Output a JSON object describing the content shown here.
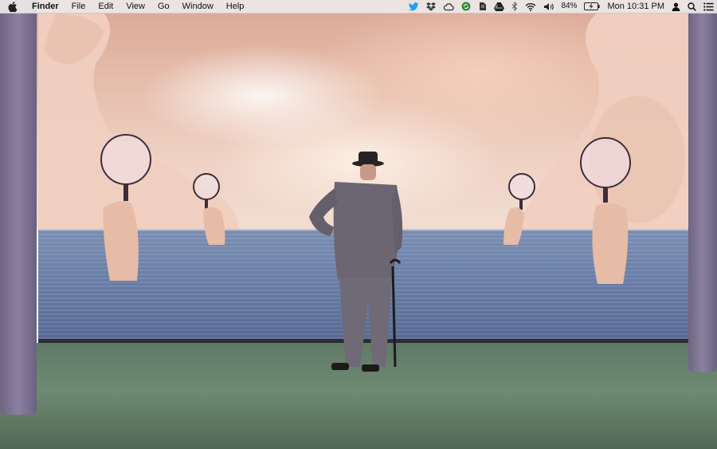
{
  "menubar": {
    "app_name": "Finder",
    "menus": [
      "File",
      "Edit",
      "View",
      "Go",
      "Window",
      "Help"
    ],
    "status_icons": [
      "twitter-bird-icon",
      "dropbox-icon",
      "cloud-app-icon",
      "sync-icon",
      "evernote-icon",
      "google-drive-icon",
      "bluetooth-icon",
      "wifi-icon",
      "volume-icon"
    ],
    "battery_percent": "84%",
    "clock": "Mon 10:31 PM",
    "accent_twitter": "#1da1f2"
  },
  "wallpaper": {
    "description_colors": {
      "sky": "#e6bcaa",
      "sea": "#6f84ae",
      "floor": "#6f8a72",
      "pillar": "#8c80a0"
    }
  }
}
